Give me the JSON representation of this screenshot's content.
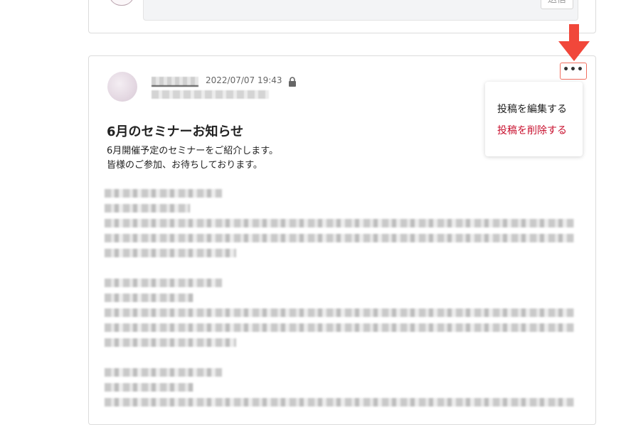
{
  "top_card": {
    "send_label": "送信"
  },
  "post": {
    "timestamp": "2022/07/07 19:43",
    "title": "6月のセミナーお知らせ",
    "body_lines": [
      "6月開催予定のセミナーをご紹介します。",
      "皆様のご参加、お待ちしております。"
    ],
    "more_label": "•••"
  },
  "menu": {
    "edit_label": "投稿を編集する",
    "delete_label": "投稿を削除する"
  },
  "icons": {
    "lock": "lock-icon",
    "arrow": "arrow-down-icon"
  },
  "colors": {
    "highlight": "#f16e5f",
    "arrow": "#f1473a",
    "delete": "#c8102e"
  }
}
